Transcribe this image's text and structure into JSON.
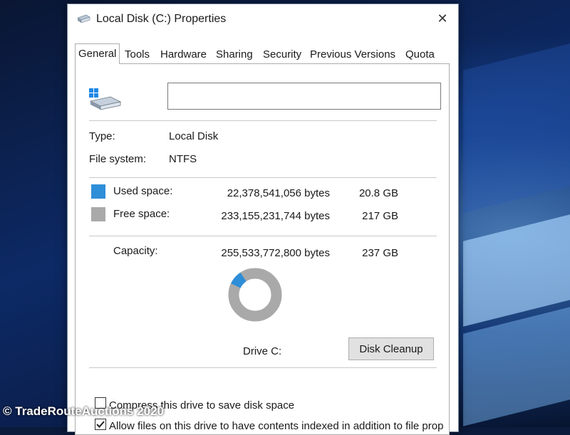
{
  "window": {
    "title": "Local Disk (C:) Properties",
    "close_glyph": "✕"
  },
  "tabs": [
    "General",
    "Tools",
    "Hardware",
    "Sharing",
    "Security",
    "Previous Versions",
    "Quota"
  ],
  "active_tab": "General",
  "drive": {
    "label_value": "",
    "type_label": "Type:",
    "type_value": "Local Disk",
    "fs_label": "File system:",
    "fs_value": "NTFS"
  },
  "space": {
    "used": {
      "label": "Used space:",
      "bytes": "22,378,541,056 bytes",
      "size": "20.8 GB",
      "color": "#2f8ed8"
    },
    "free": {
      "label": "Free space:",
      "bytes": "233,155,231,744 bytes",
      "size": "217 GB",
      "color": "#a9a9a9"
    },
    "capacity": {
      "label": "Capacity:",
      "bytes": "255,533,772,800 bytes",
      "size": "237 GB"
    },
    "used_fraction": 0.0876
  },
  "drive_caption": "Drive C:",
  "disk_cleanup_label": "Disk Cleanup",
  "options": {
    "compress_label": "Compress this drive to save disk space",
    "compress_checked": false,
    "index_label": "Allow files on this drive to have contents indexed in addition to file properties",
    "index_checked": true
  },
  "watermark": "© TradeRouteAuctions 2020"
}
